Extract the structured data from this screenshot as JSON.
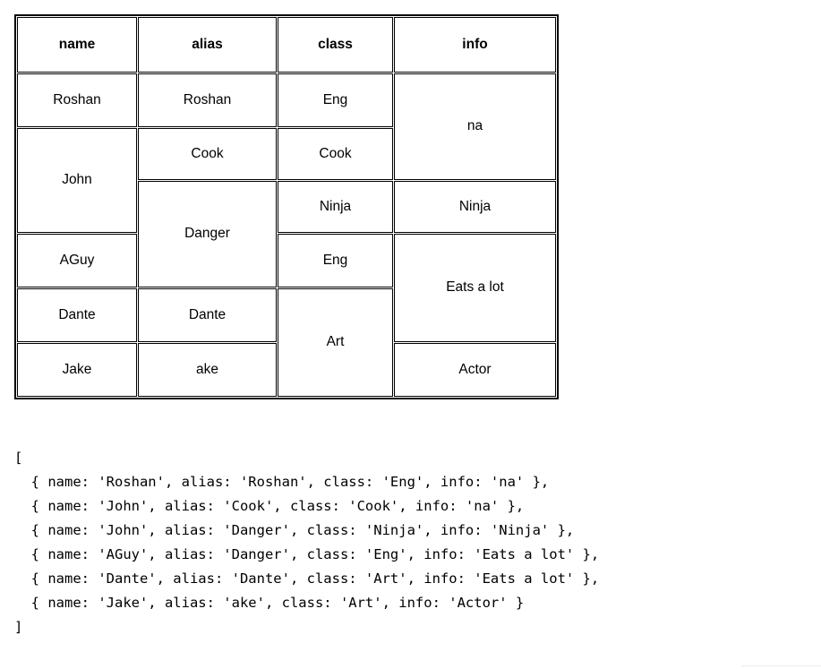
{
  "table": {
    "headers": [
      "name",
      "alias",
      "class",
      "info"
    ],
    "cells": {
      "name": [
        {
          "text": "Roshan",
          "span": 1
        },
        {
          "text": "John",
          "span": 2
        },
        {
          "text": "AGuy",
          "span": 1
        },
        {
          "text": "Dante",
          "span": 1
        },
        {
          "text": "Jake",
          "span": 1
        }
      ],
      "alias": [
        {
          "text": "Roshan",
          "span": 1
        },
        {
          "text": "Cook",
          "span": 1
        },
        {
          "text": "Danger",
          "span": 2
        },
        {
          "text": "Dante",
          "span": 1
        },
        {
          "text": "ake",
          "span": 1
        }
      ],
      "class": [
        {
          "text": "Eng",
          "span": 1
        },
        {
          "text": "Cook",
          "span": 1
        },
        {
          "text": "Ninja",
          "span": 1
        },
        {
          "text": "Eng",
          "span": 1
        },
        {
          "text": "Art",
          "span": 2
        }
      ],
      "info": [
        {
          "text": "na",
          "span": 2
        },
        {
          "text": "Ninja",
          "span": 1
        },
        {
          "text": "Eats a lot",
          "span": 2
        },
        {
          "text": "Actor",
          "span": 1
        }
      ]
    },
    "rows_source": [
      {
        "name": "Roshan",
        "alias": "Roshan",
        "class": "Eng",
        "info": "na"
      },
      {
        "name": "John",
        "alias": "Cook",
        "class": "Cook",
        "info": "na"
      },
      {
        "name": "John",
        "alias": "Danger",
        "class": "Ninja",
        "info": "Ninja"
      },
      {
        "name": "AGuy",
        "alias": "Danger",
        "class": "Eng",
        "info": "Eats a lot"
      },
      {
        "name": "Dante",
        "alias": "Dante",
        "class": "Art",
        "info": "Eats a lot"
      },
      {
        "name": "Jake",
        "alias": "ake",
        "class": "Art",
        "info": "Actor"
      }
    ]
  },
  "code": {
    "lines": [
      "[",
      "  { name: 'Roshan', alias: 'Roshan', class: 'Eng', info: 'na' },",
      "  { name: 'John', alias: 'Cook', class: 'Cook', info: 'na' },",
      "  { name: 'John', alias: 'Danger', class: 'Ninja', info: 'Ninja' },",
      "  { name: 'AGuy', alias: 'Danger', class: 'Eng', info: 'Eats a lot' },",
      "  { name: 'Dante', alias: 'Dante', class: 'Art', info: 'Eats a lot' },",
      "  { name: 'Jake', alias: 'ake', class: 'Art', info: 'Actor' }",
      "]"
    ]
  }
}
